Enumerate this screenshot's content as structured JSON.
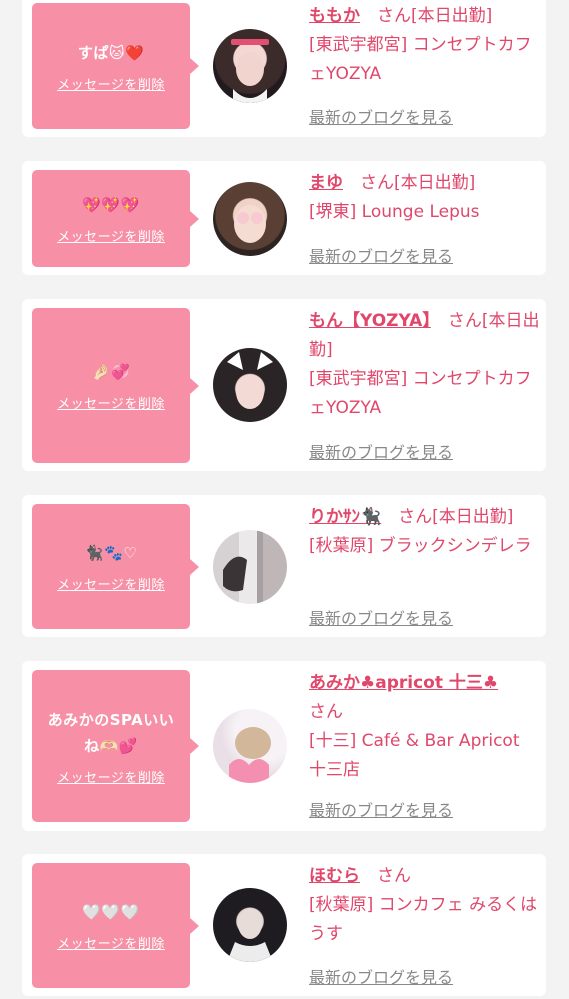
{
  "delete_label": "メッセージを削除",
  "blog_label": "最新のブログを見る",
  "cards": [
    {
      "message": "すぱ🐱❤️",
      "name": "ももか",
      "suffix": "　さん[本日出勤]",
      "shop": "[東武宇都宮] コンセプトカフェYOZYA"
    },
    {
      "message": "💖💖💖",
      "name": "まゆ",
      "suffix": "　さん[本日出勤]",
      "shop": "[堺東] Lounge Lepus"
    },
    {
      "message": "🤌🏻💞",
      "name": "もん【YOZYA】",
      "suffix": "　さん[本日出勤]",
      "shop": "[東武宇都宮] コンセプトカフェYOZYA"
    },
    {
      "message": "🐈‍⬛🐾♡",
      "name": "りかｻﾝ🐈‍⬛",
      "suffix": "　さん[本日出勤]",
      "shop": "[秋葉原] ブラックシンデレラ"
    },
    {
      "message": "あみかのSPAいいね🫶🏻💕",
      "name": "あみか♣apricot 十三♣",
      "suffix": "さん",
      "shop": "[十三] Café & Bar Apricot 十三店"
    },
    {
      "message": "🤍🤍🤍",
      "name": "ほむら",
      "suffix": "　さん",
      "shop": "[秋葉原] コンカフェ みるくはうす"
    }
  ],
  "colors": {
    "bubble": "#f790a6",
    "accent": "#e0476b",
    "link_gray": "#888888",
    "background": "#f3f3f3"
  }
}
